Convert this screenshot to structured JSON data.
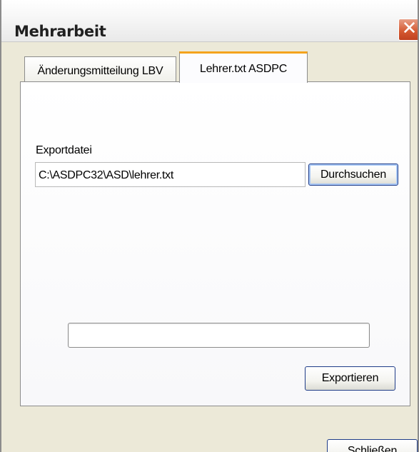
{
  "window": {
    "title": "Mehrarbeit",
    "close_glyph": "✕"
  },
  "tabs": [
    {
      "label": "Änderungsmitteilung LBV",
      "active": false
    },
    {
      "label": "Lehrer.txt ASDPC",
      "active": true
    }
  ],
  "export": {
    "field_label": "Exportdatei",
    "path_value": "C:\\ASDPC32\\ASD\\lehrer.txt",
    "browse_label": "Durchsuchen",
    "progress_fraction": 0,
    "export_label": "Exportieren"
  },
  "footer": {
    "close_label": "Schließen"
  },
  "colors": {
    "active_tab_accent": "#f4a31d",
    "default_button_border": "#1f3c88",
    "close_button": "#d4572f",
    "window_background": "#ece9d8"
  },
  "icons": {
    "close": "close-icon"
  }
}
